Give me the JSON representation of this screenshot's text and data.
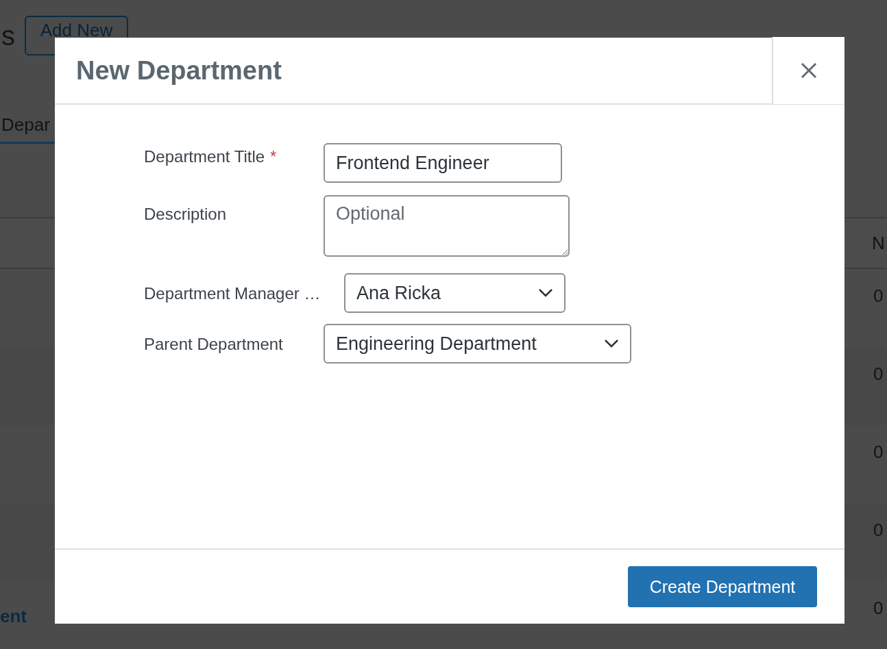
{
  "background": {
    "heading": "s",
    "add_new_button": "Add New",
    "tab": {
      "label": "Depar",
      "selected": true
    },
    "table": {
      "column_header": "N",
      "rows": [
        {
          "count": "0"
        },
        {
          "count": "0"
        },
        {
          "count": "0"
        },
        {
          "count": "0"
        },
        {
          "name_link": "ent",
          "count": "0"
        }
      ]
    }
  },
  "modal": {
    "title": "New Department",
    "fields": [
      {
        "kind": "text",
        "label": "Department Title",
        "required_mark": "*",
        "value": "Frontend Engineer"
      },
      {
        "kind": "textarea",
        "label": "Description",
        "placeholder": "Optional"
      },
      {
        "kind": "select",
        "label": "Department Manager …",
        "value": "Ana Ricka"
      },
      {
        "kind": "select",
        "label": "Parent Department",
        "value": "Engineering Department"
      }
    ],
    "submit_button": "Create Department"
  }
}
